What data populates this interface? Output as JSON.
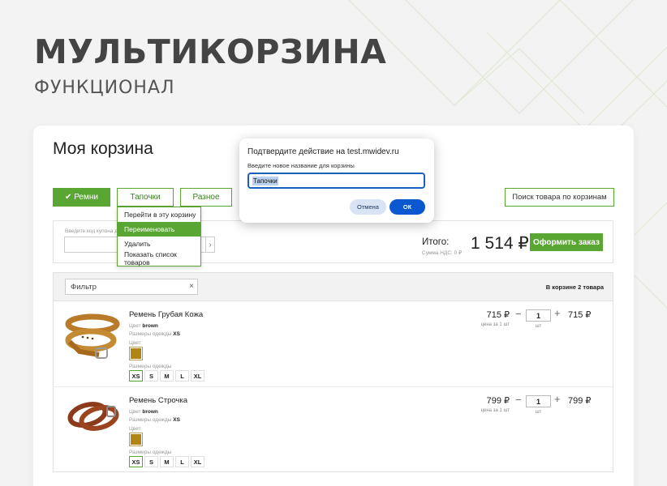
{
  "hero": {
    "title": "МУЛЬТИКОРЗИНА",
    "subtitle": "ФУНКЦИОНАЛ"
  },
  "cart": {
    "title": "Моя корзина",
    "tabs": [
      {
        "label": "✔ Ремни",
        "active": true
      },
      {
        "label": "Тапочки",
        "active": false
      },
      {
        "label": "Разное",
        "active": false
      }
    ],
    "search_label": "Поиск товара по корзинам",
    "context_menu": [
      {
        "label": "Перейти в эту корзину",
        "active": false
      },
      {
        "label": "Переименовать",
        "active": true
      },
      {
        "label": "Удалить",
        "active": false
      },
      {
        "label": "Показать список товаров",
        "active": false
      }
    ],
    "coupon": {
      "label": "Введите код купона для",
      "arrow": "›"
    },
    "total": {
      "label": "Итого:",
      "vat": "Сумма НДС: 0 ₽",
      "value": "1 514 ₽"
    },
    "checkout_label": "Оформить заказ",
    "filter": {
      "value": "Фильтр",
      "clear": "×"
    },
    "count_label": "В корзине 2 товара",
    "items": [
      {
        "name": "Ремень Грубая Кожа",
        "color_label": "Цвет",
        "color_value": "brown",
        "size_label": "Размеры одежды",
        "size_value": "XS",
        "color_picker_label": "Цвет",
        "sizes_picker_label": "Размеры одежды",
        "sizes": [
          "XS",
          "S",
          "M",
          "L",
          "XL"
        ],
        "selected_size": "XS",
        "price": "715 ₽",
        "per_unit": "цена за 1 шт",
        "minus": "−",
        "qty": "1",
        "unit": "шт",
        "plus": "+",
        "sum": "715 ₽"
      },
      {
        "name": "Ремень Строчка",
        "color_label": "Цвет",
        "color_value": "brown",
        "size_label": "Размеры одежды",
        "size_value": "XS",
        "color_picker_label": "Цвет",
        "sizes_picker_label": "Размеры одежды",
        "sizes": [
          "XS",
          "S",
          "M",
          "L",
          "XL"
        ],
        "selected_size": "XS",
        "price": "799 ₽",
        "per_unit": "цена за 1 шт",
        "minus": "−",
        "qty": "1",
        "unit": "шт",
        "plus": "+",
        "sum": "799 ₽"
      }
    ]
  },
  "dialog": {
    "title": "Подтвердите действие на test.mwidev.ru",
    "prompt": "Введите новое название для корзины",
    "input_value": "Тапочки",
    "cancel_label": "Отмена",
    "ok_label": "ОК"
  },
  "colors": {
    "accent": "#5aa632",
    "swatch": "#b08415",
    "dialog_ok": "#0b57d0"
  }
}
